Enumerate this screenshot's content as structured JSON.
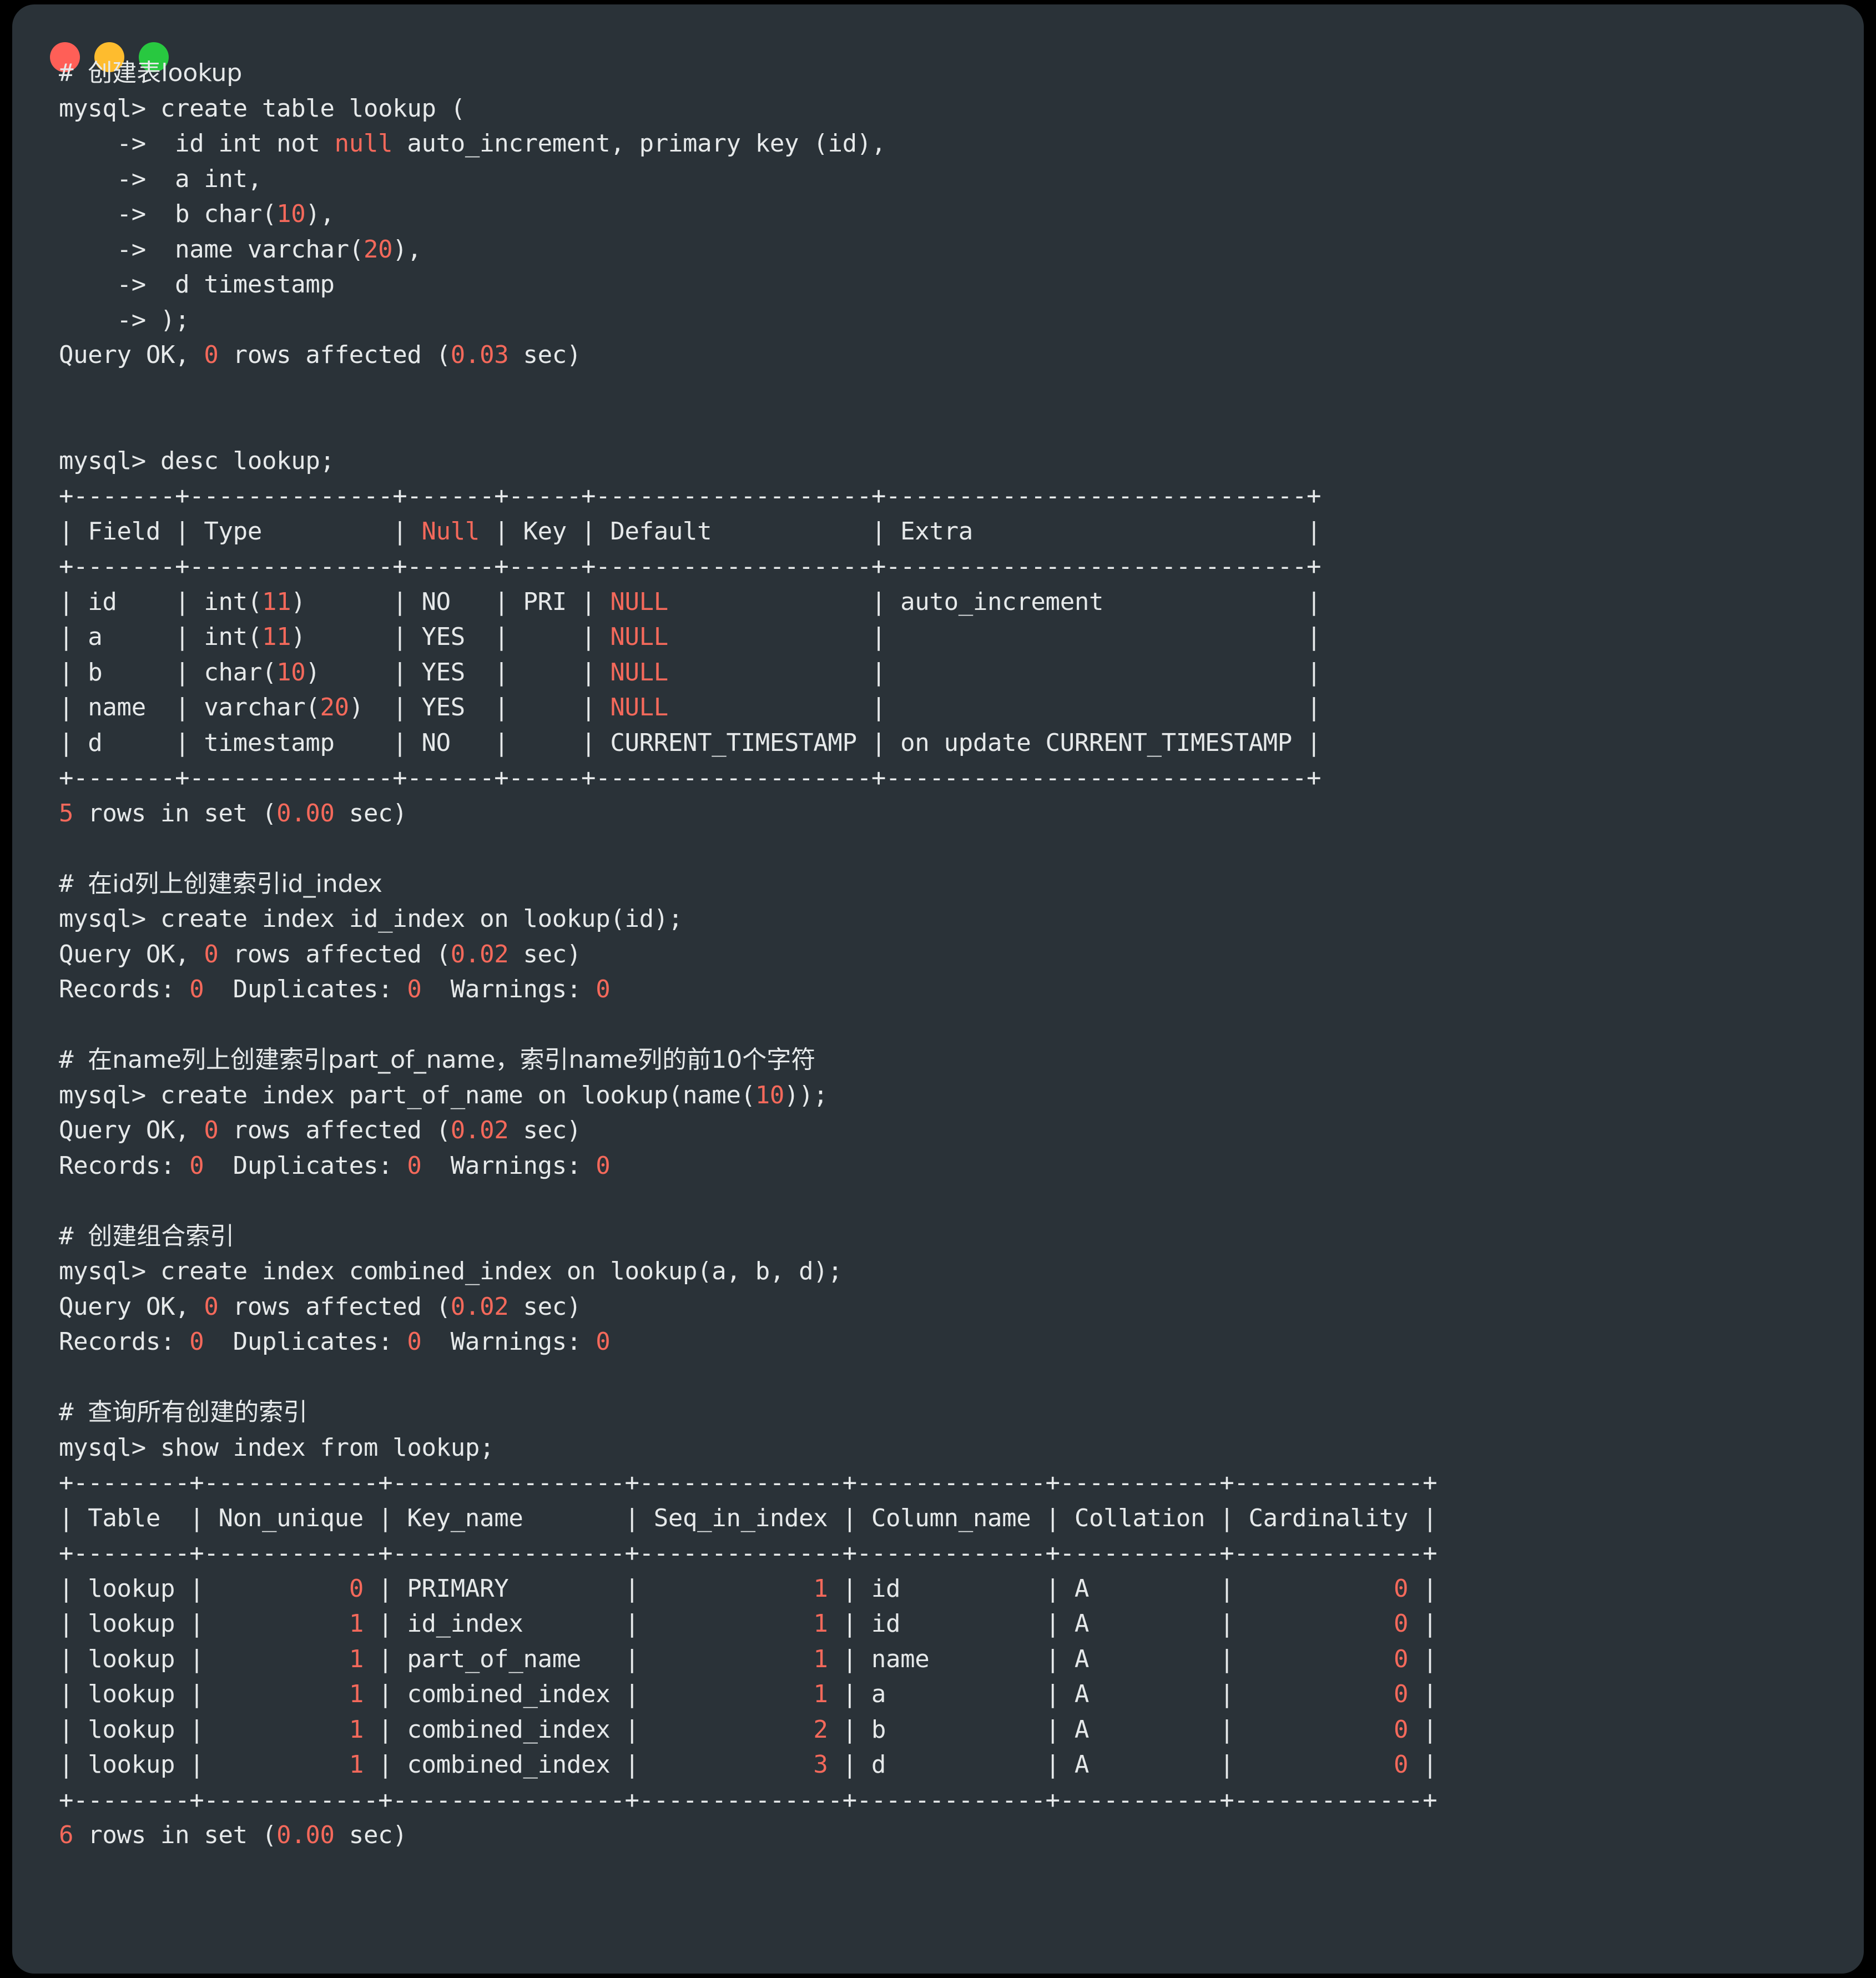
{
  "window": {
    "traffic_lights": [
      {
        "name": "close",
        "color": "#FF5F57"
      },
      {
        "name": "minimize",
        "color": "#FEBC2E"
      },
      {
        "name": "maximize",
        "color": "#28C840"
      }
    ],
    "background": "#2A3238",
    "text_color": "#E6E9EA",
    "accent_color": "#F4695B"
  },
  "terminal": {
    "prompt": "mysql>",
    "continuation": "->",
    "lines": [
      {
        "id": "l01",
        "segments": [
          {
            "t": "# "
          },
          {
            "t": "创建表lookup",
            "cjk": true
          }
        ]
      },
      {
        "id": "l02",
        "segments": [
          {
            "t": "mysql> create table lookup ("
          }
        ]
      },
      {
        "id": "l03",
        "segments": [
          {
            "t": "    ->  id int not "
          },
          {
            "t": "null",
            "c": "num"
          },
          {
            "t": " auto_increment, primary key (id),"
          }
        ]
      },
      {
        "id": "l04",
        "segments": [
          {
            "t": "    ->  a int,"
          }
        ]
      },
      {
        "id": "l05",
        "segments": [
          {
            "t": "    ->  b char("
          },
          {
            "t": "10",
            "c": "num"
          },
          {
            "t": "),"
          }
        ]
      },
      {
        "id": "l06",
        "segments": [
          {
            "t": "    ->  name varchar("
          },
          {
            "t": "20",
            "c": "num"
          },
          {
            "t": "),"
          }
        ]
      },
      {
        "id": "l07",
        "segments": [
          {
            "t": "    ->  d timestamp"
          }
        ]
      },
      {
        "id": "l08",
        "segments": [
          {
            "t": "    -> );"
          }
        ]
      },
      {
        "id": "l09",
        "segments": [
          {
            "t": "Query OK, "
          },
          {
            "t": "0",
            "c": "num"
          },
          {
            "t": " rows affected ("
          },
          {
            "t": "0.03",
            "c": "num"
          },
          {
            "t": " sec)"
          }
        ]
      },
      {
        "id": "l10",
        "segments": []
      },
      {
        "id": "l11",
        "segments": []
      },
      {
        "id": "l12",
        "segments": [
          {
            "t": "mysql> desc lookup;"
          }
        ]
      },
      {
        "id": "l13",
        "segments": [
          {
            "t": "+-------+--------------+------+-----+-------------------+-----------------------------+"
          }
        ]
      },
      {
        "id": "l14",
        "segments": [
          {
            "t": "| Field | Type         | "
          },
          {
            "t": "Null",
            "c": "num"
          },
          {
            "t": " | Key | Default           | Extra                       |"
          }
        ]
      },
      {
        "id": "l15",
        "segments": [
          {
            "t": "+-------+--------------+------+-----+-------------------+-----------------------------+"
          }
        ]
      },
      {
        "id": "l16",
        "segments": [
          {
            "t": "| id    | int("
          },
          {
            "t": "11",
            "c": "num"
          },
          {
            "t": ")      | NO   | PRI | "
          },
          {
            "t": "NULL",
            "c": "num"
          },
          {
            "t": "              | auto_increment              |"
          }
        ]
      },
      {
        "id": "l17",
        "segments": [
          {
            "t": "| a     | int("
          },
          {
            "t": "11",
            "c": "num"
          },
          {
            "t": ")      | YES  |     | "
          },
          {
            "t": "NULL",
            "c": "num"
          },
          {
            "t": "              |                             |"
          }
        ]
      },
      {
        "id": "l18",
        "segments": [
          {
            "t": "| b     | char("
          },
          {
            "t": "10",
            "c": "num"
          },
          {
            "t": ")     | YES  |     | "
          },
          {
            "t": "NULL",
            "c": "num"
          },
          {
            "t": "              |                             |"
          }
        ]
      },
      {
        "id": "l19",
        "segments": [
          {
            "t": "| name  | varchar("
          },
          {
            "t": "20",
            "c": "num"
          },
          {
            "t": ")  | YES  |     | "
          },
          {
            "t": "NULL",
            "c": "num"
          },
          {
            "t": "              |                             |"
          }
        ]
      },
      {
        "id": "l20",
        "segments": [
          {
            "t": "| d     | timestamp    | NO   |     | CURRENT_TIMESTAMP | on update CURRENT_TIMESTAMP |"
          }
        ]
      },
      {
        "id": "l21",
        "segments": [
          {
            "t": "+-------+--------------+------+-----+-------------------+-----------------------------+"
          }
        ]
      },
      {
        "id": "l22",
        "segments": [
          {
            "t": "5",
            "c": "num"
          },
          {
            "t": " rows in set ("
          },
          {
            "t": "0.00",
            "c": "num"
          },
          {
            "t": " sec)"
          }
        ]
      },
      {
        "id": "l23",
        "segments": []
      },
      {
        "id": "l24",
        "segments": [
          {
            "t": "# "
          },
          {
            "t": "在id列上创建索引id_index",
            "cjk": true
          }
        ]
      },
      {
        "id": "l25",
        "segments": [
          {
            "t": "mysql> create index id_index on lookup(id);"
          }
        ]
      },
      {
        "id": "l26",
        "segments": [
          {
            "t": "Query OK, "
          },
          {
            "t": "0",
            "c": "num"
          },
          {
            "t": " rows affected ("
          },
          {
            "t": "0.02",
            "c": "num"
          },
          {
            "t": " sec)"
          }
        ]
      },
      {
        "id": "l27",
        "segments": [
          {
            "t": "Records: "
          },
          {
            "t": "0",
            "c": "num"
          },
          {
            "t": "  Duplicates: "
          },
          {
            "t": "0",
            "c": "num"
          },
          {
            "t": "  Warnings: "
          },
          {
            "t": "0",
            "c": "num"
          }
        ]
      },
      {
        "id": "l28",
        "segments": []
      },
      {
        "id": "l29",
        "segments": [
          {
            "t": "# "
          },
          {
            "t": "在name列上创建索引part_of_name，索引name列的前10个字符",
            "cjk": true
          }
        ]
      },
      {
        "id": "l30",
        "segments": [
          {
            "t": "mysql> create index part_of_name on lookup(name("
          },
          {
            "t": "10",
            "c": "num"
          },
          {
            "t": "));"
          }
        ]
      },
      {
        "id": "l31",
        "segments": [
          {
            "t": "Query OK, "
          },
          {
            "t": "0",
            "c": "num"
          },
          {
            "t": " rows affected ("
          },
          {
            "t": "0.02",
            "c": "num"
          },
          {
            "t": " sec)"
          }
        ]
      },
      {
        "id": "l32",
        "segments": [
          {
            "t": "Records: "
          },
          {
            "t": "0",
            "c": "num"
          },
          {
            "t": "  Duplicates: "
          },
          {
            "t": "0",
            "c": "num"
          },
          {
            "t": "  Warnings: "
          },
          {
            "t": "0",
            "c": "num"
          }
        ]
      },
      {
        "id": "l33",
        "segments": []
      },
      {
        "id": "l34",
        "segments": [
          {
            "t": "# "
          },
          {
            "t": "创建组合索引",
            "cjk": true
          }
        ]
      },
      {
        "id": "l35",
        "segments": [
          {
            "t": "mysql> create index combined_index on lookup(a, b, d);"
          }
        ]
      },
      {
        "id": "l36",
        "segments": [
          {
            "t": "Query OK, "
          },
          {
            "t": "0",
            "c": "num"
          },
          {
            "t": " rows affected ("
          },
          {
            "t": "0.02",
            "c": "num"
          },
          {
            "t": " sec)"
          }
        ]
      },
      {
        "id": "l37",
        "segments": [
          {
            "t": "Records: "
          },
          {
            "t": "0",
            "c": "num"
          },
          {
            "t": "  Duplicates: "
          },
          {
            "t": "0",
            "c": "num"
          },
          {
            "t": "  Warnings: "
          },
          {
            "t": "0",
            "c": "num"
          }
        ]
      },
      {
        "id": "l38",
        "segments": []
      },
      {
        "id": "l39",
        "segments": [
          {
            "t": "# "
          },
          {
            "t": "查询所有创建的索引",
            "cjk": true
          }
        ]
      },
      {
        "id": "l40",
        "segments": [
          {
            "t": "mysql> show index from lookup;"
          }
        ]
      },
      {
        "id": "l41",
        "segments": [
          {
            "t": "+--------+------------+----------------+--------------+-------------+-----------+-------------+"
          }
        ]
      },
      {
        "id": "l42",
        "segments": [
          {
            "t": "| Table  | Non_unique | Key_name       | Seq_in_index | Column_name | Collation | Cardinality |"
          }
        ]
      },
      {
        "id": "l43",
        "segments": [
          {
            "t": "+--------+------------+----------------+--------------+-------------+-----------+-------------+"
          }
        ]
      },
      {
        "id": "l44",
        "segments": [
          {
            "t": "| lookup |          "
          },
          {
            "t": "0",
            "c": "num"
          },
          {
            "t": " | PRIMARY        |            "
          },
          {
            "t": "1",
            "c": "num"
          },
          {
            "t": " | id          | A         |           "
          },
          {
            "t": "0",
            "c": "num"
          },
          {
            "t": " |"
          }
        ]
      },
      {
        "id": "l45",
        "segments": [
          {
            "t": "| lookup |          "
          },
          {
            "t": "1",
            "c": "num"
          },
          {
            "t": " | id_index       |            "
          },
          {
            "t": "1",
            "c": "num"
          },
          {
            "t": " | id          | A         |           "
          },
          {
            "t": "0",
            "c": "num"
          },
          {
            "t": " |"
          }
        ]
      },
      {
        "id": "l46",
        "segments": [
          {
            "t": "| lookup |          "
          },
          {
            "t": "1",
            "c": "num"
          },
          {
            "t": " | part_of_name   |            "
          },
          {
            "t": "1",
            "c": "num"
          },
          {
            "t": " | name        | A         |           "
          },
          {
            "t": "0",
            "c": "num"
          },
          {
            "t": " |"
          }
        ]
      },
      {
        "id": "l47",
        "segments": [
          {
            "t": "| lookup |          "
          },
          {
            "t": "1",
            "c": "num"
          },
          {
            "t": " | combined_index |            "
          },
          {
            "t": "1",
            "c": "num"
          },
          {
            "t": " | a           | A         |           "
          },
          {
            "t": "0",
            "c": "num"
          },
          {
            "t": " |"
          }
        ]
      },
      {
        "id": "l48",
        "segments": [
          {
            "t": "| lookup |          "
          },
          {
            "t": "1",
            "c": "num"
          },
          {
            "t": " | combined_index |            "
          },
          {
            "t": "2",
            "c": "num"
          },
          {
            "t": " | b           | A         |           "
          },
          {
            "t": "0",
            "c": "num"
          },
          {
            "t": " |"
          }
        ]
      },
      {
        "id": "l49",
        "segments": [
          {
            "t": "| lookup |          "
          },
          {
            "t": "1",
            "c": "num"
          },
          {
            "t": " | combined_index |            "
          },
          {
            "t": "3",
            "c": "num"
          },
          {
            "t": " | d           | A         |           "
          },
          {
            "t": "0",
            "c": "num"
          },
          {
            "t": " |"
          }
        ]
      },
      {
        "id": "l50",
        "segments": [
          {
            "t": "+--------+------------+----------------+--------------+-------------+-----------+-------------+"
          }
        ]
      },
      {
        "id": "l51",
        "segments": [
          {
            "t": "6",
            "c": "num"
          },
          {
            "t": " rows in set ("
          },
          {
            "t": "0.00",
            "c": "num"
          },
          {
            "t": " sec)"
          }
        ]
      }
    ],
    "desc_table": {
      "type": "table",
      "headers": [
        "Field",
        "Type",
        "Null",
        "Key",
        "Default",
        "Extra"
      ],
      "rows": [
        [
          "id",
          "int(11)",
          "NO",
          "PRI",
          "NULL",
          "auto_increment"
        ],
        [
          "a",
          "int(11)",
          "YES",
          "",
          "NULL",
          ""
        ],
        [
          "b",
          "char(10)",
          "YES",
          "",
          "NULL",
          ""
        ],
        [
          "name",
          "varchar(20)",
          "YES",
          "",
          "NULL",
          ""
        ],
        [
          "d",
          "timestamp",
          "NO",
          "",
          "CURRENT_TIMESTAMP",
          "on update CURRENT_TIMESTAMP"
        ]
      ],
      "footer": "5 rows in set (0.00 sec)"
    },
    "index_table": {
      "type": "table",
      "headers": [
        "Table",
        "Non_unique",
        "Key_name",
        "Seq_in_index",
        "Column_name",
        "Collation",
        "Cardinality"
      ],
      "rows": [
        [
          "lookup",
          "0",
          "PRIMARY",
          "1",
          "id",
          "A",
          "0"
        ],
        [
          "lookup",
          "1",
          "id_index",
          "1",
          "id",
          "A",
          "0"
        ],
        [
          "lookup",
          "1",
          "part_of_name",
          "1",
          "name",
          "A",
          "0"
        ],
        [
          "lookup",
          "1",
          "combined_index",
          "1",
          "a",
          "A",
          "0"
        ],
        [
          "lookup",
          "1",
          "combined_index",
          "2",
          "b",
          "A",
          "0"
        ],
        [
          "lookup",
          "1",
          "combined_index",
          "3",
          "d",
          "A",
          "0"
        ]
      ],
      "footer": "6 rows in set (0.00 sec)"
    }
  }
}
